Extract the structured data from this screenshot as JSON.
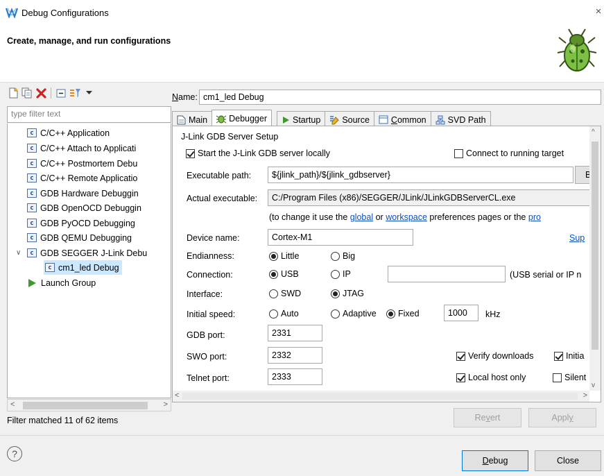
{
  "window": {
    "title": "Debug Configurations",
    "close_glyph": "×",
    "header": "Create, manage, and run configurations"
  },
  "toolbar": {
    "icons": [
      "new-configuration-icon",
      "duplicate-icon",
      "delete-icon",
      "collapse-all-icon",
      "filter-icon",
      "dropdown-arrow-icon"
    ]
  },
  "filter": {
    "placeholder": "type filter text",
    "status": "Filter matched 11 of 62 items"
  },
  "tree": {
    "items": [
      {
        "label": "C/C++ Application",
        "icon": "c",
        "level": 1
      },
      {
        "label": "C/C++ Attach to Applicati",
        "icon": "c",
        "level": 1
      },
      {
        "label": "C/C++ Postmortem Debu",
        "icon": "c",
        "level": 1
      },
      {
        "label": "C/C++ Remote Applicatio",
        "icon": "c",
        "level": 1
      },
      {
        "label": "GDB Hardware Debuggin",
        "icon": "c",
        "level": 1
      },
      {
        "label": "GDB OpenOCD Debuggin",
        "icon": "c",
        "level": 1
      },
      {
        "label": "GDB PyOCD Debugging",
        "icon": "c",
        "level": 1
      },
      {
        "label": "GDB QEMU Debugging",
        "icon": "c",
        "level": 1
      },
      {
        "label": "GDB SEGGER J-Link Debu",
        "icon": "c",
        "level": 1,
        "expanded": true
      },
      {
        "label": "cm1_led Debug",
        "icon": "c",
        "level": 2,
        "selected": true
      },
      {
        "label": "Launch Group",
        "icon": "launch",
        "level": 1
      }
    ],
    "icon_letter": "c",
    "twisty_glyph": "∨"
  },
  "config": {
    "name_label_prefix": "N",
    "name_label_rest": "ame:",
    "name_value": "cm1_led Debug"
  },
  "tabs": [
    {
      "label": "Main",
      "icon": "main-tab-icon"
    },
    {
      "label": "Debugger",
      "icon": "debugger-tab-icon",
      "active": true
    },
    {
      "label": "Startup",
      "icon": "startup-tab-icon"
    },
    {
      "label": "Source",
      "icon": "source-tab-icon"
    },
    {
      "pre": "",
      "mn": "C",
      "post": "ommon",
      "icon": "common-tab-icon"
    },
    {
      "label": "SVD Path",
      "icon": "svd-tab-icon"
    }
  ],
  "debugger": {
    "group_title": "J-Link GDB Server Setup",
    "start_server_label": "Start the J-Link GDB server locally",
    "start_server_checked": true,
    "connect_running_label": "Connect to running target",
    "connect_running_checked": false,
    "exec_path_label": "Executable path:",
    "exec_path_value": "${jlink_path}/${jlink_gdbserver}",
    "browse_label": "Br",
    "actual_exec_label": "Actual executable:",
    "actual_exec_value": "C:/Program Files (x86)/SEGGER/JLink/JLinkGDBServerCL.exe",
    "hint_prefix": "(to change it use the ",
    "hint_global": "global",
    "hint_or": " or ",
    "hint_workspace": "workspace",
    "hint_suffix": " preferences pages or the ",
    "hint_pro": "pro",
    "device_label": "Device name:",
    "device_value": "Cortex-M1",
    "supported_link": "Sup",
    "endianness_label": "Endianness:",
    "endian_little": "Little",
    "endian_big": "Big",
    "endianness_selected": "Little",
    "connection_label": "Connection:",
    "conn_usb": "USB",
    "conn_ip": "IP",
    "connection_selected": "USB",
    "connection_value": "",
    "connection_hint": "(USB serial or IP n",
    "interface_label": "Interface:",
    "iface_swd": "SWD",
    "iface_jtag": "JTAG",
    "interface_selected": "JTAG",
    "speed_label": "Initial speed:",
    "speed_auto": "Auto",
    "speed_adaptive": "Adaptive",
    "speed_fixed": "Fixed",
    "speed_selected": "Fixed",
    "speed_value": "1000",
    "speed_unit": "kHz",
    "gdb_port_label": "GDB port:",
    "gdb_port_value": "2331",
    "swo_port_label": "SWO port:",
    "swo_port_value": "2332",
    "telnet_port_label": "Telnet port:",
    "telnet_port_value": "2333",
    "verify_downloads_label": "Verify downloads",
    "verify_downloads_checked": true,
    "initial_label": "Initia",
    "initial_checked": true,
    "local_host_label": "Local host only",
    "local_host_checked": true,
    "silent_label": "Silent",
    "silent_checked": false
  },
  "buttons": {
    "revert_pre": "Re",
    "revert_mn": "v",
    "revert_post": "ert",
    "apply_pre": "Appl",
    "apply_mn": "y",
    "apply_post": "",
    "debug_pre": "",
    "debug_mn": "D",
    "debug_post": "ebug",
    "close": "Close"
  },
  "help_glyph": "?",
  "colors": {
    "selection": "#cce8ff",
    "link": "#0b4fbd",
    "launch_green": "#3e9a2e",
    "dialog_bg": "#f0f0f0",
    "default_button_border": "#0078d7"
  }
}
